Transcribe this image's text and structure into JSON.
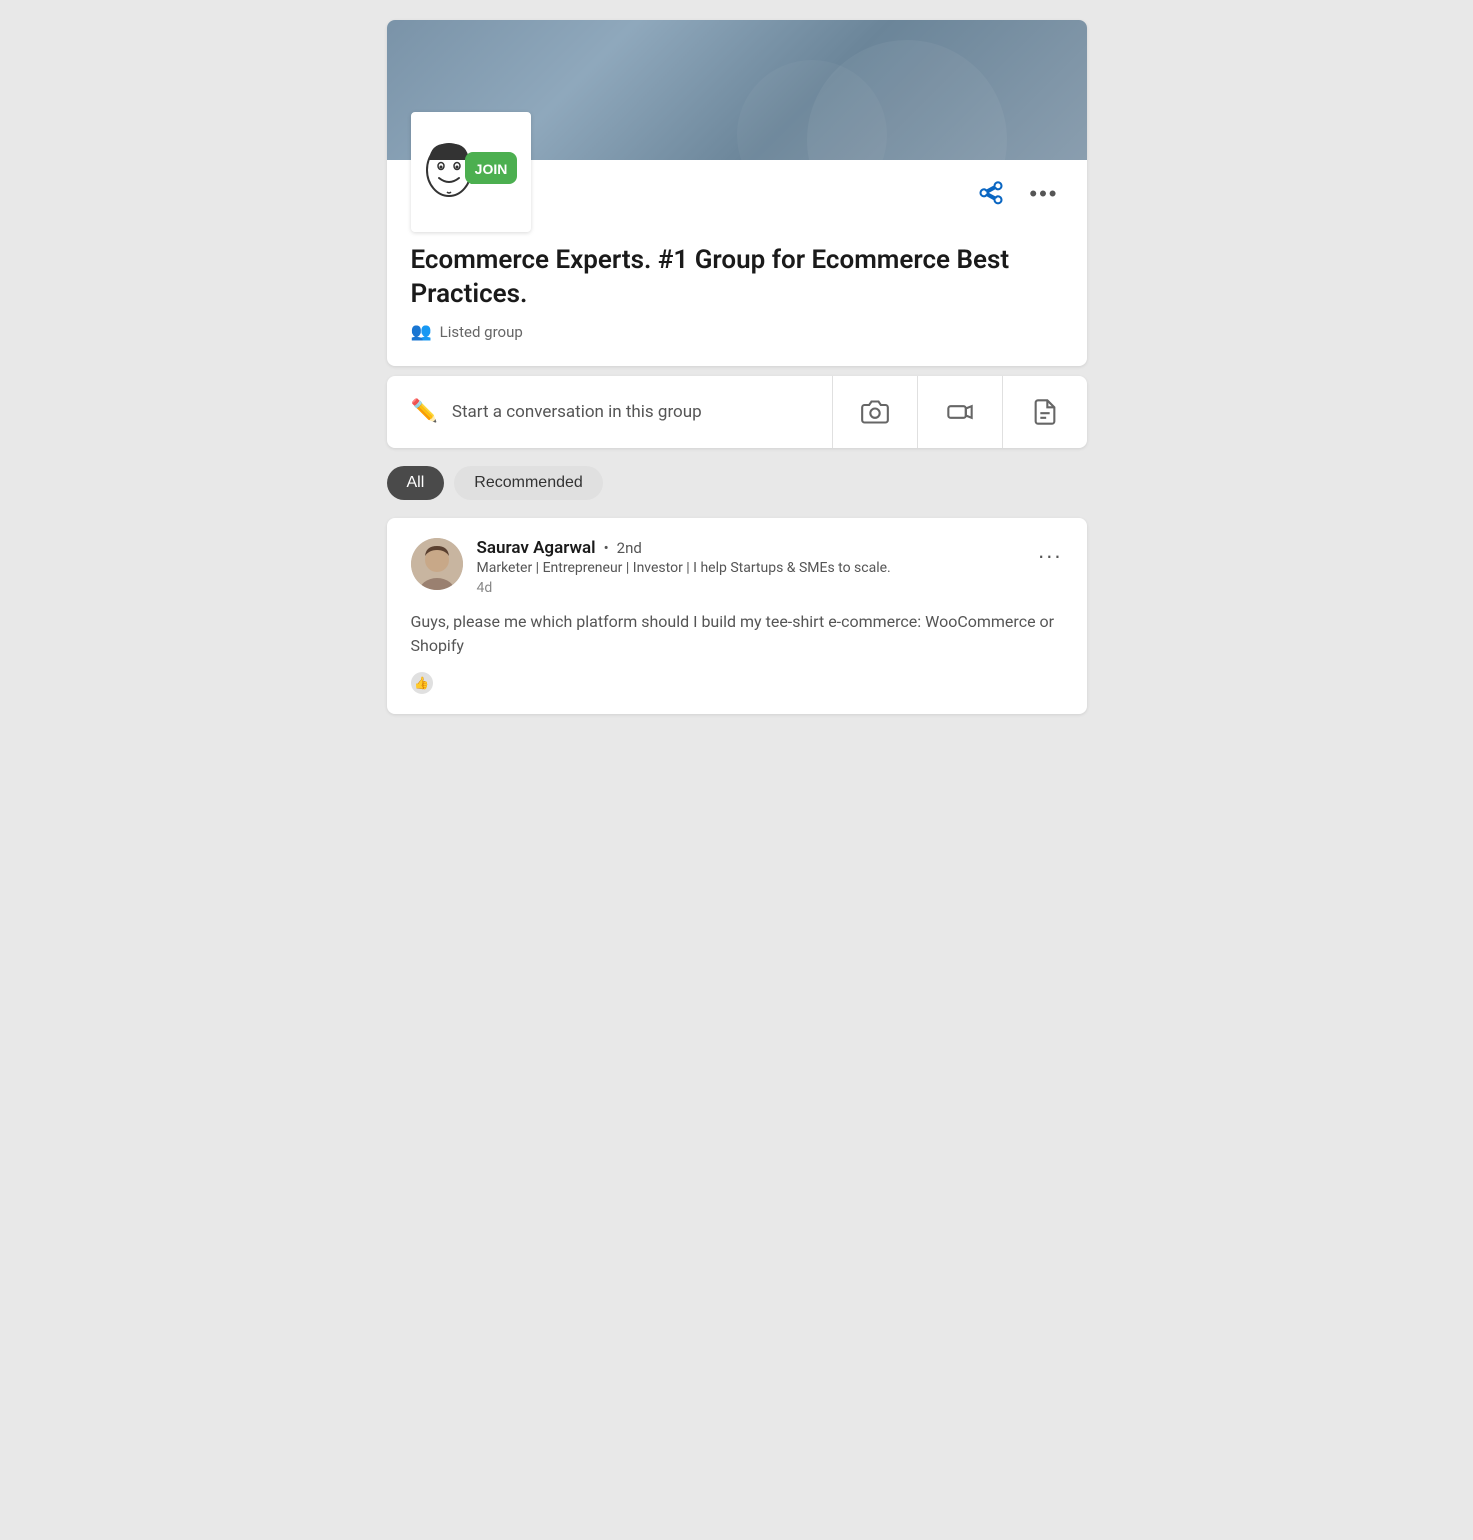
{
  "group": {
    "title": "Ecommerce Experts.  #1 Group for Ecommerce Best Practices.",
    "type": "Listed group",
    "listed_label": "Listed group"
  },
  "composer": {
    "placeholder": "Start a conversation in this group",
    "photo_label": "Photo",
    "video_label": "Video",
    "document_label": "Document"
  },
  "filters": {
    "all_label": "All",
    "recommended_label": "Recommended",
    "active_filter": "All"
  },
  "post": {
    "author_name": "Saurav Agarwal",
    "author_degree": "2nd",
    "author_tagline": "Marketer | Entrepreneur | Investor | I help Startups & SMEs to scale.",
    "post_time": "4d",
    "post_content": "Guys, please me which platform should I build my tee-shirt e-commerce: WooCommerce or Shopify",
    "more_options_label": "..."
  },
  "icons": {
    "share": "share-icon",
    "more": "more-options-icon",
    "pencil": "✏",
    "camera": "📷",
    "video": "🎬",
    "document": "📄",
    "people": "👥"
  }
}
